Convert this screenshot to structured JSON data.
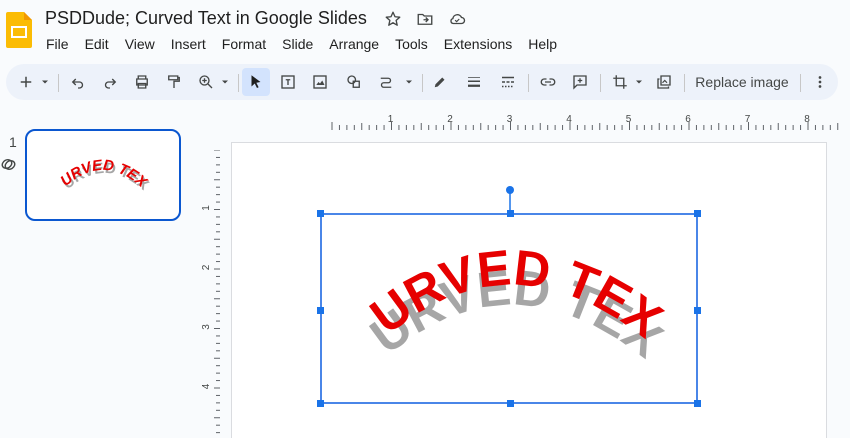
{
  "app": {
    "title": "PSDDude; Curved Text in Google Slides",
    "logo_color": "#fbbc04"
  },
  "menu": [
    "File",
    "Edit",
    "View",
    "Insert",
    "Format",
    "Slide",
    "Arrange",
    "Tools",
    "Extensions",
    "Help"
  ],
  "toolbar": {
    "replace_image_label": "Replace image"
  },
  "filmstrip": {
    "slide_number": "1",
    "slide_text": "CURVED TEXT"
  },
  "slide": {
    "curved_text": "CURVED TEXT",
    "text_color": "#e60000",
    "shadow_color": "#a6a6a6"
  },
  "rulers": {
    "top_ticks": [
      "1",
      "2",
      "3",
      "4",
      "5",
      "6",
      "7",
      "8"
    ],
    "left_ticks": [
      "1",
      "2",
      "3",
      "4"
    ]
  },
  "colors": {
    "accent": "#0b57d0",
    "selection": "#4a86e8",
    "toolbar_bg": "#edf2fa"
  }
}
